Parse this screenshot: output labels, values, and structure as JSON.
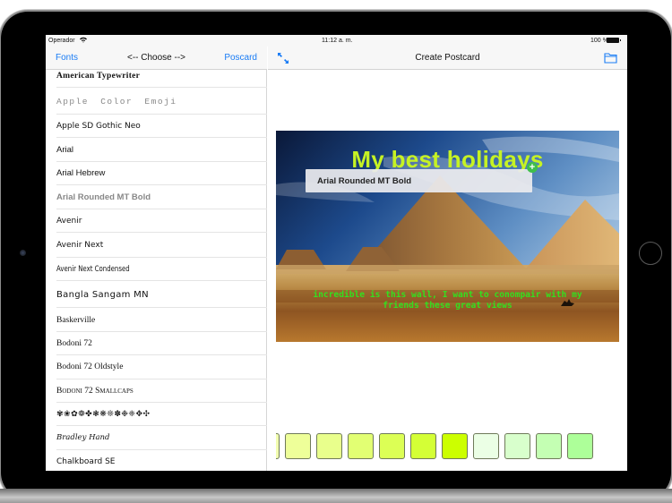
{
  "status_bar": {
    "carrier": "Operador",
    "time": "11:12 a. m.",
    "battery": "100 %"
  },
  "left_nav": {
    "back_label": "Fonts",
    "title": "<-- Choose -->",
    "forward_label": "Poscard"
  },
  "font_list": [
    {
      "name": "American Typewriter"
    },
    {
      "name": "Apple  Color  Emoji"
    },
    {
      "name": "Apple SD Gothic Neo"
    },
    {
      "name": "Arial"
    },
    {
      "name": "Arial Hebrew"
    },
    {
      "name": "Arial Rounded MT Bold"
    },
    {
      "name": "Avenir"
    },
    {
      "name": "Avenir Next"
    },
    {
      "name": "Avenir Next Condensed"
    },
    {
      "name": "Bangla Sangam MN"
    },
    {
      "name": "Baskerville"
    },
    {
      "name": "Bodoni 72"
    },
    {
      "name": "Bodoni 72 Oldstyle"
    },
    {
      "name": "Bodoni 72 Smallcaps"
    },
    {
      "name": "✾❀✿❁✤❃❋❊✽❉❈✥✣"
    },
    {
      "name": "Bradley Hand"
    },
    {
      "name": "Chalkboard SE"
    }
  ],
  "right_nav": {
    "expand_icon": "expand-arrows-icon",
    "title": "Create Postcard",
    "folder_icon": "folder-icon"
  },
  "postcard": {
    "title": "My best holidays",
    "title_color": "#c6f224",
    "selected_font_tooltip": "Arial Rounded MT Bold",
    "add_handle_symbol": "+",
    "caption": "incredible is this wall, I want to conompair with my friends these great views",
    "caption_color": "#33e01f"
  },
  "color_swatches": [
    "#f2ffb0",
    "#eeff99",
    "#e9ff8c",
    "#e2ff73",
    "#dcff55",
    "#d4ff36",
    "#ccff00",
    "#ebffe5",
    "#d8ffcc",
    "#c4ffb3",
    "#adff99"
  ],
  "colors": {
    "accent": "#1a7cf5",
    "nav_background": "#f7f7f7"
  }
}
